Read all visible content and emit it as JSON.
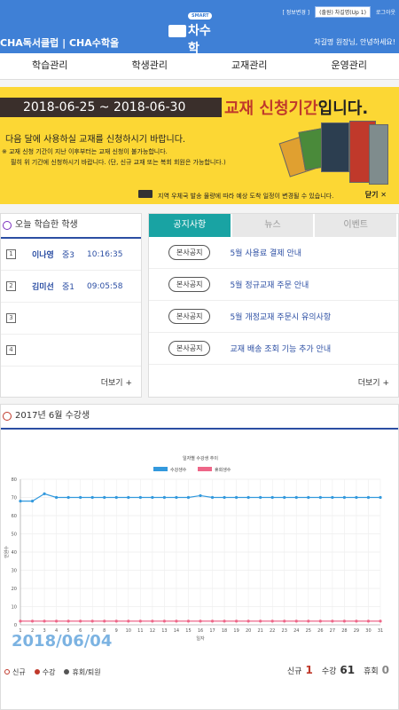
{
  "header": {
    "info_change": "[ 정보변경 ]",
    "account_select": "(출원) 차길명(Up 1)",
    "logout": "로그아웃",
    "brand": "CHA독서클럽 | CHA수학올",
    "logo_badge": "SMART",
    "logo_name": "차수학",
    "greeting": "차길명 원장님, 안녕하세요!"
  },
  "nav": [
    "학습관리",
    "학생관리",
    "교재관리",
    "운영관리"
  ],
  "banner": {
    "dates": "2018-06-25 ~ 2018-06-30",
    "apply_red": "교재 신청기간",
    "apply_black": "입니다.",
    "main": "다음 달에 사용하실 교재를 신청하시기 바랍니다.",
    "note1": "※ 교재 신청 기간이 지난 이후부터는 교재 신청이 불가능합니다.",
    "note2": "필히 위 기간에 신청하시기 바랍니다. (단, 신규 교재 또는 복회 회원은 가능합니다.)",
    "footer": "지역 우체국 발송 물량에 따라 예상 도착 일정이 변경될 수 있습니다.",
    "close": "닫기 ✕"
  },
  "students": {
    "title": "오늘 학습한 학생",
    "rows": [
      {
        "num": "1",
        "name": "이나영",
        "grade": "중3",
        "time": "10:16:35"
      },
      {
        "num": "2",
        "name": "김미선",
        "grade": "중1",
        "time": "09:05:58"
      },
      {
        "num": "3",
        "name": "",
        "grade": "",
        "time": ""
      },
      {
        "num": "4",
        "name": "",
        "grade": "",
        "time": ""
      }
    ],
    "more": "더보기 +"
  },
  "notices": {
    "tabs": [
      "공지사항",
      "뉴스",
      "이벤트"
    ],
    "rows": [
      {
        "badge": "본사공지",
        "title": "5월 사용료 결제 안내"
      },
      {
        "badge": "본사공지",
        "title": "5월 정규교재 주문 안내"
      },
      {
        "badge": "본사공지",
        "title": "5월 개정교재 주문시 유의사항"
      },
      {
        "badge": "본사공지",
        "title": "교재 배송 조회 기능 추가 안내"
      }
    ],
    "more": "더보기 +"
  },
  "chart_section": {
    "title": "2017년 6월 수강생",
    "watermark": "2018/06/04",
    "legend": [
      "신규",
      "수강",
      "휴회/퇴원"
    ],
    "stats": [
      {
        "label": "신규",
        "value": "1",
        "color": "#c0392b"
      },
      {
        "label": "수강",
        "value": "61",
        "color": "#222"
      },
      {
        "label": "휴회",
        "value": "0",
        "color": "#888"
      }
    ]
  },
  "chart_data": {
    "type": "line",
    "title": "일자별 수강생 추이",
    "xlabel": "일자",
    "ylabel": "인원수",
    "ylim": [
      0,
      80
    ],
    "yticks": [
      0,
      10,
      20,
      30,
      40,
      50,
      60,
      70,
      80
    ],
    "x": [
      1,
      2,
      3,
      4,
      5,
      6,
      7,
      8,
      9,
      10,
      11,
      12,
      13,
      14,
      15,
      16,
      17,
      18,
      19,
      20,
      21,
      22,
      23,
      24,
      25,
      26,
      27,
      28,
      29,
      30,
      31
    ],
    "series": [
      {
        "name": "수강생수",
        "color": "#3399dd",
        "values": [
          68,
          68,
          72,
          70,
          70,
          70,
          70,
          70,
          70,
          70,
          70,
          70,
          70,
          70,
          70,
          71,
          70,
          70,
          70,
          70,
          70,
          70,
          70,
          70,
          70,
          70,
          70,
          70,
          70,
          70,
          70
        ]
      },
      {
        "name": "휴회생수",
        "color": "#ee6688",
        "values": [
          2,
          2,
          2,
          2,
          2,
          2,
          2,
          2,
          2,
          2,
          2,
          2,
          2,
          2,
          2,
          2,
          2,
          2,
          2,
          2,
          2,
          2,
          2,
          2,
          2,
          2,
          2,
          2,
          2,
          2,
          2
        ]
      }
    ],
    "grid": true,
    "legend_position": "top-center"
  }
}
